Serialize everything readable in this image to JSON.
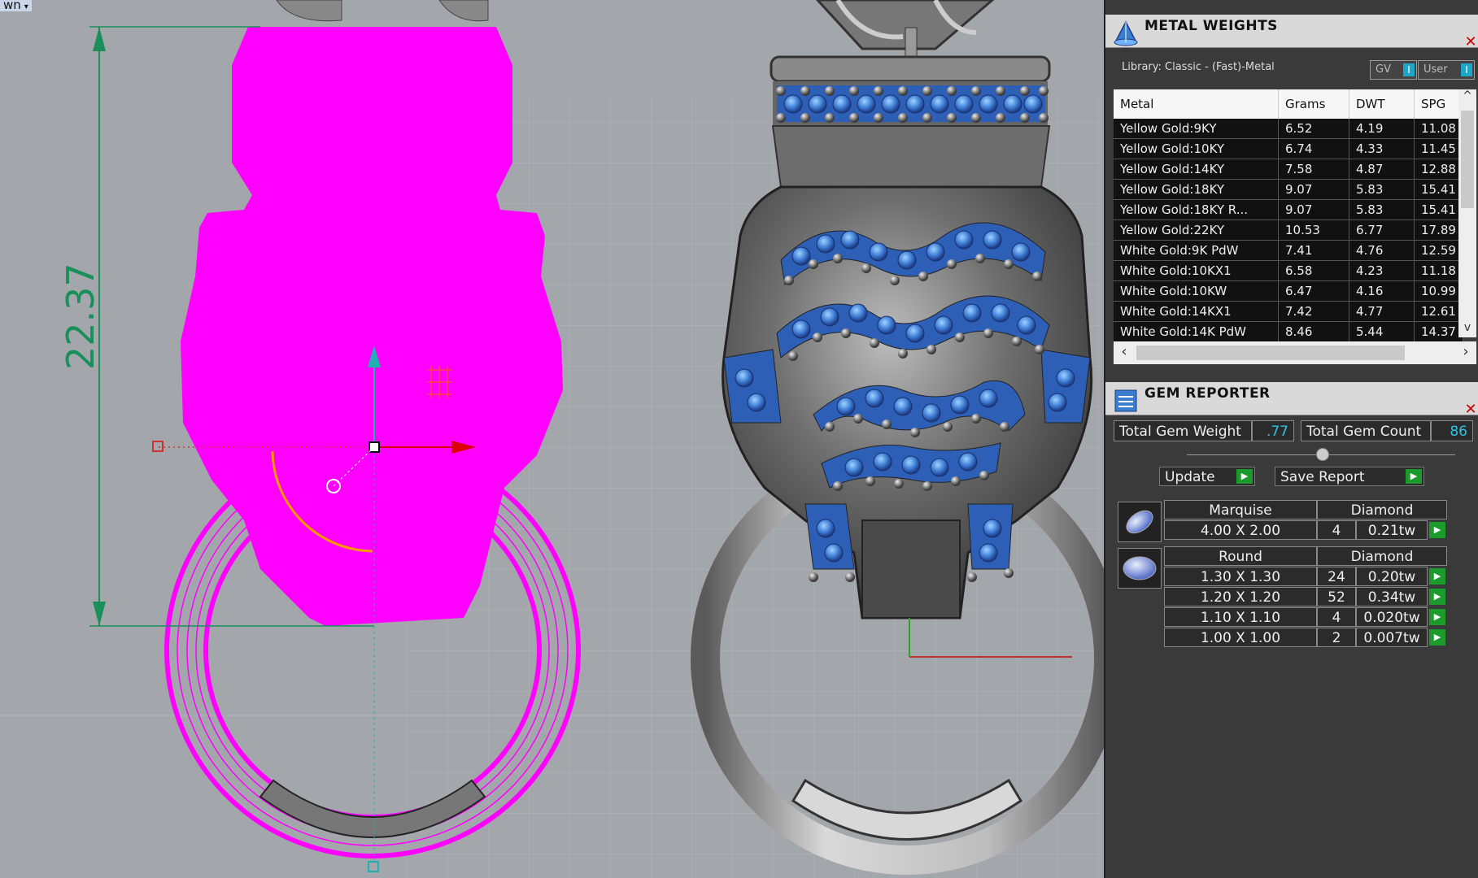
{
  "viewport": {
    "label": "wn",
    "dimension_text": "22.37"
  },
  "metal_weights": {
    "title": "METAL WEIGHTS",
    "library": "Library: Classic - (Fast)-Metal",
    "toggle_gv": "GV",
    "toggle_user": "User",
    "columns": [
      "Metal",
      "Grams",
      "DWT",
      "SPG"
    ],
    "rows": [
      [
        "Yellow Gold:9KY",
        "6.52",
        "4.19",
        "11.08"
      ],
      [
        "Yellow Gold:10KY",
        "6.74",
        "4.33",
        "11.45"
      ],
      [
        "Yellow Gold:14KY",
        "7.58",
        "4.87",
        "12.88"
      ],
      [
        "Yellow Gold:18KY",
        "9.07",
        "5.83",
        "15.41"
      ],
      [
        "Yellow Gold:18KY R...",
        "9.07",
        "5.83",
        "15.41"
      ],
      [
        "Yellow Gold:22KY",
        "10.53",
        "6.77",
        "17.89"
      ],
      [
        "White Gold:9K PdW",
        "7.41",
        "4.76",
        "12.59"
      ],
      [
        "White Gold:10KX1",
        "6.58",
        "4.23",
        "11.18"
      ],
      [
        "White Gold:10KW",
        "6.47",
        "4.16",
        "10.99"
      ],
      [
        "White Gold:14KX1",
        "7.42",
        "4.77",
        "12.61"
      ],
      [
        "White Gold:14K PdW",
        "8.46",
        "5.44",
        "14.37"
      ]
    ]
  },
  "gem_reporter": {
    "title": "GEM REPORTER",
    "total_weight_label": "Total Gem Weight",
    "total_weight_value": ".77",
    "total_count_label": "Total Gem Count",
    "total_count_value": "86",
    "update_label": "Update",
    "save_label": "Save Report",
    "marquise": {
      "shape": "Marquise",
      "material": "Diamond",
      "rows": [
        [
          "4.00 X 2.00",
          "4",
          "0.21tw"
        ]
      ]
    },
    "round": {
      "shape": "Round",
      "material": "Diamond",
      "rows": [
        [
          "1.30 X 1.30",
          "24",
          "0.20tw"
        ],
        [
          "1.20 X 1.20",
          "52",
          "0.34tw"
        ],
        [
          "1.10 X 1.10",
          "4",
          "0.020tw"
        ],
        [
          "1.00 X 1.00",
          "2",
          "0.007tw"
        ]
      ]
    }
  }
}
